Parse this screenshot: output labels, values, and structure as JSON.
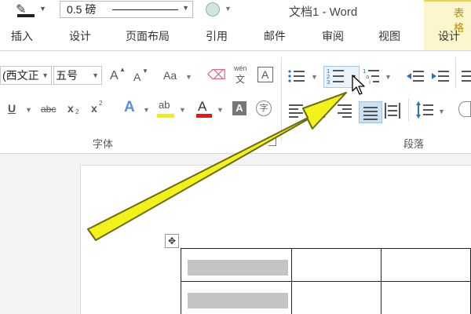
{
  "title_row": {
    "line_weight_value": "0.5 磅",
    "document_title": "文档1 - Word",
    "context_tab_group_label": "表格"
  },
  "tabs": {
    "insert": "插入",
    "design": "设计",
    "layout": "页面布局",
    "references": "引用",
    "mailings": "邮件",
    "review": "审阅",
    "view": "视图",
    "table_design": "设计"
  },
  "font_group": {
    "font_name": "(西文正",
    "font_size": "五号",
    "grow_icon": "A",
    "shrink_icon": "A",
    "change_case": "Aa",
    "phonetic_top": "wén",
    "phonetic_bottom": "文",
    "char_border": "A",
    "underline": "U",
    "strikethrough": "abc",
    "subscript": "x",
    "subscript_mark": "2",
    "superscript": "x",
    "superscript_mark": "2",
    "text_effects": "A",
    "highlight": "ab",
    "font_color": "A",
    "char_shading": "A",
    "enclosed_char": "字",
    "label": "字体"
  },
  "paragraph_group": {
    "label": "段落"
  },
  "colors": {
    "arrow": "#f2f21a",
    "arrow_outline": "#6b6b10",
    "selection": "#cde1f5",
    "context_tab": "#fdf6cc"
  }
}
